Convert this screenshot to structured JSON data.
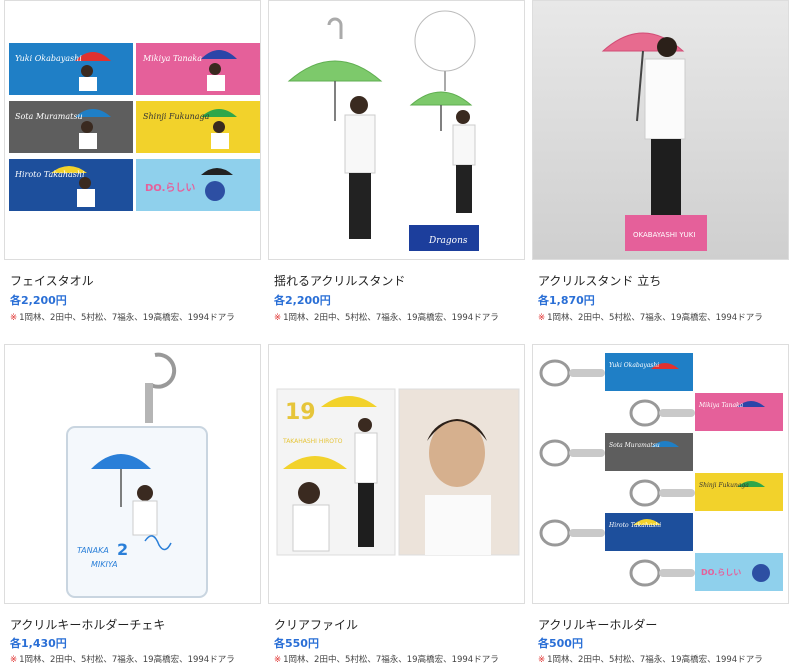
{
  "products": [
    {
      "title": "フェイスタオル",
      "price": "各2,200円",
      "note_mark": "※",
      "note": "1岡林、2田中、5村松、7福永、19高橋宏、1994ドアラ"
    },
    {
      "title": "揺れるアクリルスタンド",
      "price": "各2,200円",
      "note_mark": "※",
      "note": "1岡林、2田中、5村松、7福永、19高橋宏、1994ドアラ"
    },
    {
      "title": "アクリルスタンド 立ち",
      "price": "各1,870円",
      "note_mark": "※",
      "note": "1岡林、2田中、5村松、7福永、19高橋宏、1994ドアラ"
    },
    {
      "title": "アクリルキーホルダーチェキ",
      "price": "各1,430円",
      "note_mark": "※",
      "note": "1岡林、2田中、5村松、7福永、19高橋宏、1994ドアラ"
    },
    {
      "title": "クリアファイル",
      "price": "各550円",
      "note_mark": "※",
      "note": "1岡林、2田中、5村松、7福永、19高橋宏、1994ドアラ"
    },
    {
      "title": "アクリルキーホルダー",
      "price": "各500円",
      "note_mark": "※",
      "note": "1岡林、2田中、5村松、7福永、19高橋宏、1994ドアラ"
    }
  ],
  "image_text": {
    "towels": [
      "Yuki Okabayashi",
      "Mikiya Tanaka",
      "Sota Muramatsu",
      "Shinji Fukunaga",
      "Hiroto Takahashi",
      "DO.らしい"
    ],
    "stand_name": "OKABAYASHI YUKI",
    "cheki_name": "TANAKA",
    "cheki_first": "MIKIYA",
    "cheki_number": "2",
    "file_number": "19",
    "file_name": "TAKAHASHI HIROTO",
    "logo": "Dragons"
  },
  "colors": {
    "price": "#2a6fd6",
    "note_mark": "#e0312f",
    "towel_blue": "#1f7fc6",
    "towel_pink": "#e5609a",
    "towel_gray": "#5e5e5e",
    "towel_yellow": "#f2d22b",
    "towel_navy": "#1d4f9c",
    "towel_sky": "#8fd0ec"
  }
}
